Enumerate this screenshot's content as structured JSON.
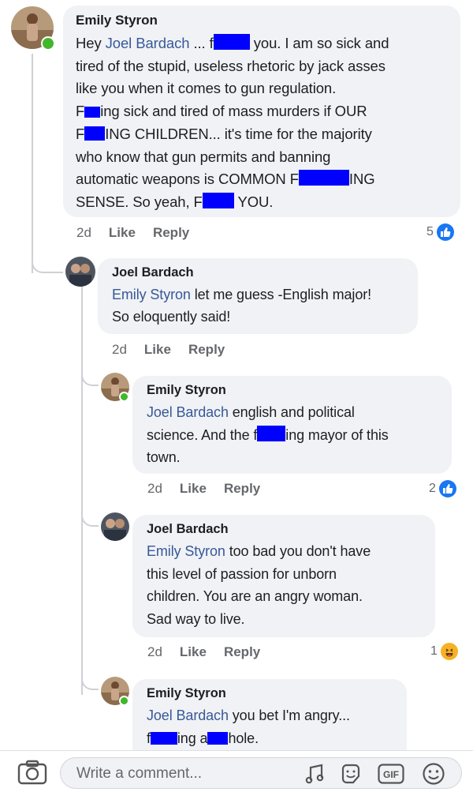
{
  "comments": [
    {
      "author": "Emily Styron",
      "mention": "Joel Bardach",
      "pre": "Hey ",
      "part1": " ... f",
      "part2": " you. I am so sick and\ntired of the stupid, useless rhetoric by jack asses\nlike you when it comes to gun regulation.\nF",
      "part3": "ing sick and tired of mass murders if OUR\nF",
      "part4": "ING CHILDREN... it's time for the majority\nwho know that gun permits and banning\nautomatic weapons is COMMON F",
      "part5": "ING\nSENSE.  So yeah, F",
      "part6": " YOU.",
      "time": "2d",
      "like": "Like",
      "reply": "Reply",
      "reaction_count": "5",
      "reaction_icon": "like-icon"
    },
    {
      "author": "Joel Bardach",
      "mention": "Emily Styron",
      "part1": " let me guess -English major!\nSo eloquently said!",
      "time": "2d",
      "like": "Like",
      "reply": "Reply"
    },
    {
      "author": "Emily Styron",
      "mention": "Joel Bardach",
      "part1": " english and political\nscience. And the f",
      "part2": "ing mayor of this\ntown.",
      "time": "2d",
      "like": "Like",
      "reply": "Reply",
      "reaction_count": "2",
      "reaction_icon": "like-icon"
    },
    {
      "author": "Joel Bardach",
      "mention": "Emily Styron",
      "part1": " too bad you don't have\nthis level of passion for unborn\nchildren.  You are an angry woman.\nSad way to live.",
      "time": "2d",
      "like": "Like",
      "reply": "Reply",
      "reaction_count": "1",
      "reaction_icon": "haha-icon"
    },
    {
      "author": "Emily Styron",
      "mention": "Joel Bardach",
      "part1": " you bet I'm angry...\nf",
      "part2": "ing a",
      "part3": "hole."
    }
  ],
  "composer": {
    "placeholder": "Write a comment...",
    "icons": [
      "camera-icon",
      "sticker-icon",
      "emoji-sticker-icon",
      "gif-icon",
      "emoji-icon"
    ],
    "gif_label": "GIF"
  },
  "colors": {
    "mention": "#385898",
    "redaction": "#0000ff",
    "bubble": "#f0f2f5",
    "online": "#42b72a",
    "like_reaction": "#1877f2",
    "haha_reaction": "#f7b125"
  }
}
